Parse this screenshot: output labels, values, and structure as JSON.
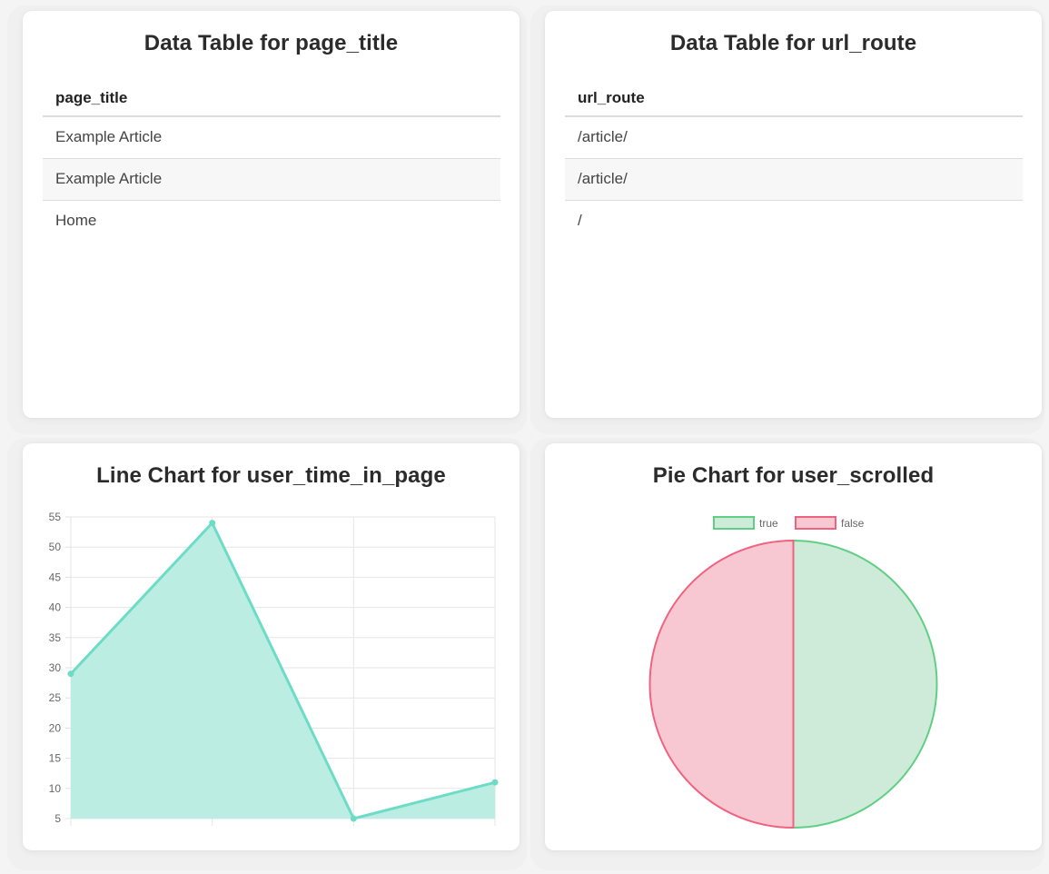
{
  "cards": {
    "page_title_table": {
      "title": "Data Table for page_title",
      "header": "page_title",
      "rows": [
        "Example Article",
        "Example Article",
        "Home"
      ]
    },
    "url_route_table": {
      "title": "Data Table for url_route",
      "header": "url_route",
      "rows": [
        "/article/",
        "/article/",
        "/"
      ]
    },
    "line_chart": {
      "title": "Line Chart for user_time_in_page"
    },
    "pie_chart": {
      "title": "Pie Chart for user_scrolled"
    }
  },
  "colors": {
    "line_stroke": "#6ddcc7",
    "line_fill": "#bcede3",
    "pie_true_fill": "#cdebd8",
    "pie_true_stroke": "#5fcf84",
    "pie_false_fill": "#f8c8d2",
    "pie_false_stroke": "#f0637f"
  },
  "chart_data": [
    {
      "type": "area",
      "title": "Line Chart for user_time_in_page",
      "x": [
        1,
        2,
        3,
        4
      ],
      "values": [
        29,
        54,
        5,
        11
      ],
      "ylim": [
        5,
        55
      ],
      "yticks": [
        55,
        50,
        45,
        40,
        35,
        30,
        25,
        20,
        15,
        10,
        5
      ],
      "grid": true,
      "legend": "none"
    },
    {
      "type": "pie",
      "title": "Pie Chart for user_scrolled",
      "categories": [
        "true",
        "false"
      ],
      "values": [
        1,
        1
      ],
      "legend": "top"
    }
  ]
}
